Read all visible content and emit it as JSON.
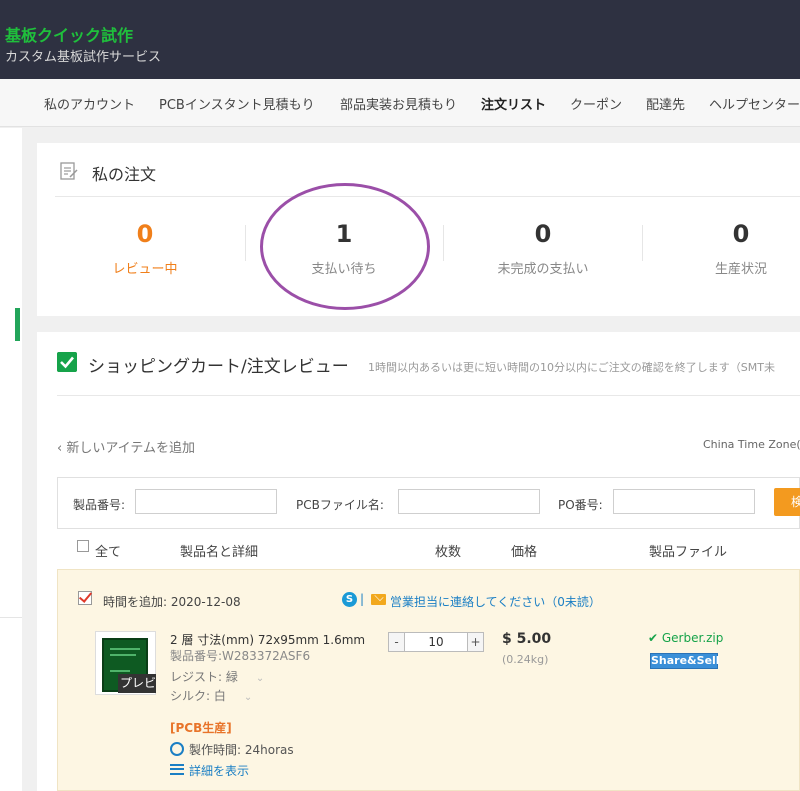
{
  "header": {
    "brand": "基板クイック試作",
    "subtitle": "カスタム基板試作サービス"
  },
  "nav": {
    "items": [
      "私のアカウント",
      "PCBインスタント見積もり",
      "部品実装お見積もり",
      "注文リスト",
      "クーポン",
      "配達先",
      "ヘルプセンター"
    ],
    "active": "注文リスト"
  },
  "orders": {
    "title": "私の注文",
    "stats": [
      {
        "value": "0",
        "label": "レビュー中"
      },
      {
        "value": "1",
        "label": "支払い待ち"
      },
      {
        "value": "0",
        "label": "未完成の支払い"
      },
      {
        "value": "0",
        "label": "生産状況"
      }
    ],
    "colors": {
      "accent": "#f07f1a",
      "annotation": "#9b4fa8"
    }
  },
  "cart": {
    "title": "ショッピングカート/注文レビュー",
    "note": "1時間以内あるいは更に短い時間の10分以内にご注文の確認を終了します（SMT未",
    "add_item": "‹ 新しいアイテムを追加",
    "timezone": "China Time Zone(G",
    "filters": {
      "product_no_label": "製品番号:",
      "pcb_file_label": "PCBファイル名:",
      "po_label": "PO番号:",
      "search_label": "検"
    },
    "columns": {
      "all": "全て",
      "name": "製品名と詳細",
      "qty": "枚数",
      "price": "価格",
      "file": "製品ファイル"
    },
    "order": {
      "added_time": "時間を追加: 2020-12-08",
      "separator": "|",
      "contact": "営業担当に連絡してください（0未読）",
      "preview": "プレビュー",
      "spec": "2 層 寸法(mm) 72x95mm 1.6mm",
      "product_no": "製品番号:W283372ASF6",
      "resist": "レジスト: 緑",
      "silk": "シルク: 白",
      "tag": "[PCB生産]",
      "lead_time": "製作時間: 24horas",
      "details_link": "詳細を表示",
      "qty": "10",
      "minus": "-",
      "plus": "+",
      "price": "$ 5.00",
      "weight": "(0.24kg)",
      "file": "✔ Gerber.zip",
      "share": "Share&Sell",
      "skype_glyph": "S"
    }
  }
}
